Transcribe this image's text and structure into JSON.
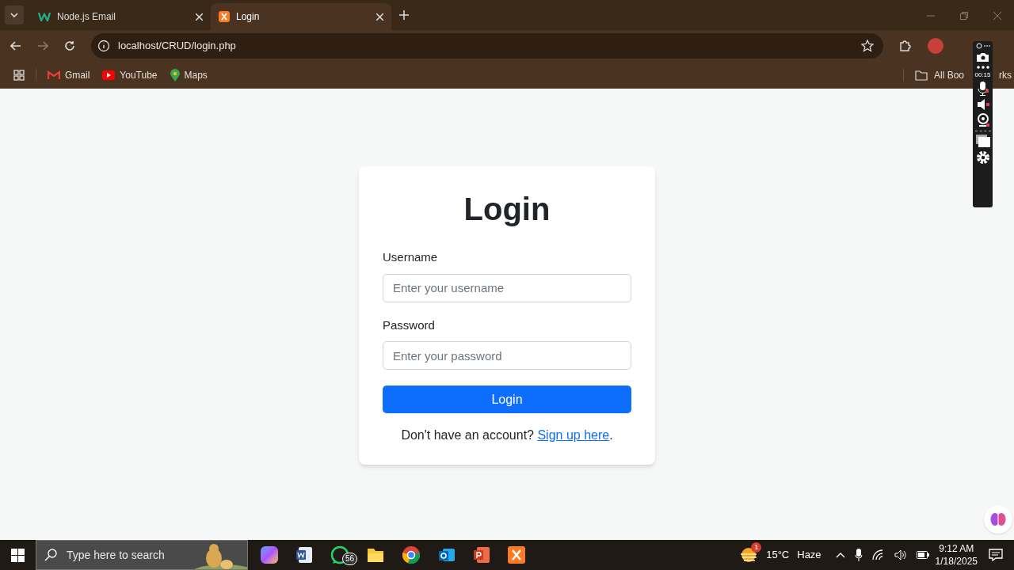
{
  "browser": {
    "tabs": [
      {
        "title": "Node.js Email",
        "selected": false
      },
      {
        "title": "Login",
        "selected": true
      }
    ],
    "address": "localhost/CRUD/login.php",
    "bookmarks": [
      "Gmail",
      "YouTube",
      "Maps"
    ],
    "all_bookmarks": {
      "visible_start": "All Boo",
      "visible_end": "rks"
    }
  },
  "recorder": {
    "timer": "00:15"
  },
  "login": {
    "title": "Login",
    "fields": [
      {
        "label": "Username",
        "placeholder": "Enter your username"
      },
      {
        "label": "Password",
        "placeholder": "Enter your password"
      }
    ],
    "button": "Login",
    "signup_text": "Don't have an account?",
    "signup_link": "Sign up here",
    "signup_end": "."
  },
  "taskbar": {
    "search_placeholder": "Type here to search",
    "whatsapp_badge": "56",
    "weather_badge": "1",
    "temperature": "15°C",
    "weather": "Haze",
    "time": "9:12 AM",
    "date": "1/18/2025"
  }
}
